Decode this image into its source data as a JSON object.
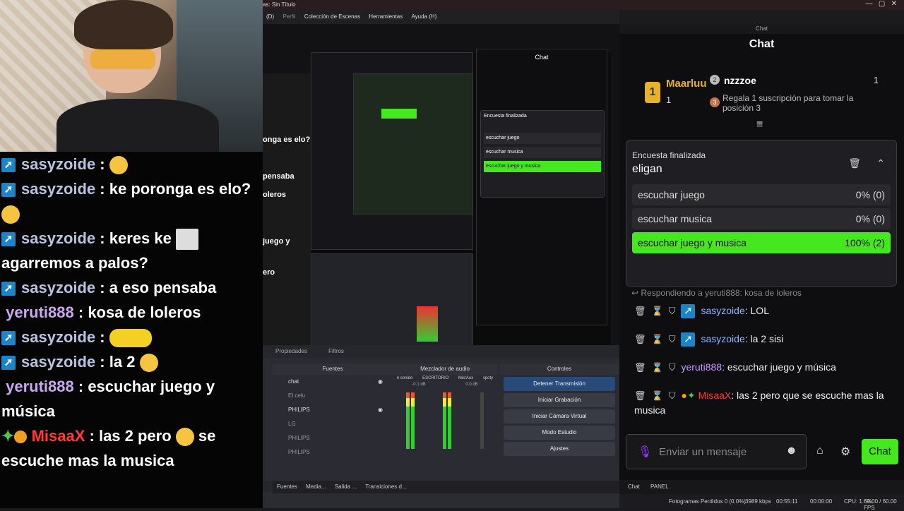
{
  "obs": {
    "title": "as: Sin Título",
    "menu": [
      "(D)",
      "Perfil",
      "Colección de Escenas",
      "Herramientas",
      "Ayuda (H)"
    ],
    "tabs_bottom": [
      "Propiedades",
      "Filtros"
    ],
    "docks": {
      "sources": "Fuentes",
      "mixer": "Mezclador de audio",
      "controls": "Controles"
    },
    "sources": [
      "chat",
      "El celu",
      "PHILIPS",
      "LG",
      "PHILIPS",
      "PHILIPS"
    ],
    "mixer": {
      "channels": [
        "n sonido",
        "ESCRITORIO",
        "Mic/Aux",
        "spoty"
      ],
      "db": [
        "-0.1 dB",
        "0.0 dB"
      ]
    },
    "controls": [
      "Detener Transmisión",
      "Iniciar Grabación",
      "Iniciar Cámara Virtual",
      "Modo Estudio",
      "Ajustes"
    ],
    "bottom_tabs": [
      "Fuentes",
      "Media...",
      "Salida ...",
      "Transiciones d..."
    ],
    "status": {
      "dropped": "Fotogramas Perdidos 0 (0.0%)",
      "kbps": "3989 kbps",
      "live": "00:55:11",
      "rec": "00:00:00",
      "cpu": "CPU: 1.6%",
      "fps": "60.00 / 60.00 FPS"
    },
    "right_tabs": [
      "Chat",
      "PANEL"
    ],
    "preview_left": [
      "onga es elo?",
      "pensaba",
      "oleros",
      "juego y",
      "ero"
    ]
  },
  "left_chat": [
    {
      "user": "sasyzoide",
      "text": ""
    },
    {
      "user": "sasyzoide",
      "text": "ke poronga es elo?"
    },
    {
      "user": "sasyzoide",
      "text": "keres ke",
      "text2": "agarremos a palos?"
    },
    {
      "user": "sasyzoide",
      "text": "a eso pensaba"
    },
    {
      "user": "yeruti888",
      "text": "kosa de loleros"
    },
    {
      "user": "sasyzoide",
      "text": ""
    },
    {
      "user": "sasyzoide",
      "text": "la 2"
    },
    {
      "user": "yeruti888",
      "text": "escuchar juego y",
      "text2": "música"
    },
    {
      "user": "MisaaX",
      "text": "las 2 pero",
      "text_after": "se",
      "text2": "escuche mas la musica"
    }
  ],
  "right_chat": {
    "window_title": "Chat",
    "header": "Chat",
    "leaderboard": {
      "first": {
        "name": "Maarluu",
        "count": "1"
      },
      "second": {
        "name": "nzzzoe",
        "count": "1"
      },
      "third_text": "Regala 1 suscripción para tomar la posición 3"
    },
    "poll": {
      "status": "Encuesta finalizada",
      "title": "eligan",
      "options": [
        {
          "label": "escuchar juego",
          "result": "0% (0)"
        },
        {
          "label": "escuchar musica",
          "result": "0% (0)"
        },
        {
          "label": "escuchar juego y musica",
          "result": "100% (2)"
        }
      ]
    },
    "reply": "Respondiendo a yeruti888: kosa de loleros",
    "messages": [
      {
        "user": "sasyzoide",
        "text": "LOL"
      },
      {
        "user": "sasyzoide",
        "text": "la 2 sisi"
      },
      {
        "user": "yeruti888",
        "text": "escuchar juego y música"
      },
      {
        "user": "MisaaX",
        "text": "las 2 pero que se escuche mas la",
        "text2": "musica"
      }
    ],
    "input_placeholder": "Enviar un mensaje",
    "send": "Chat"
  },
  "colors": {
    "accent": "#45e81f",
    "poll_bg": "#1f1f23",
    "twitch": "#1e84c8"
  }
}
